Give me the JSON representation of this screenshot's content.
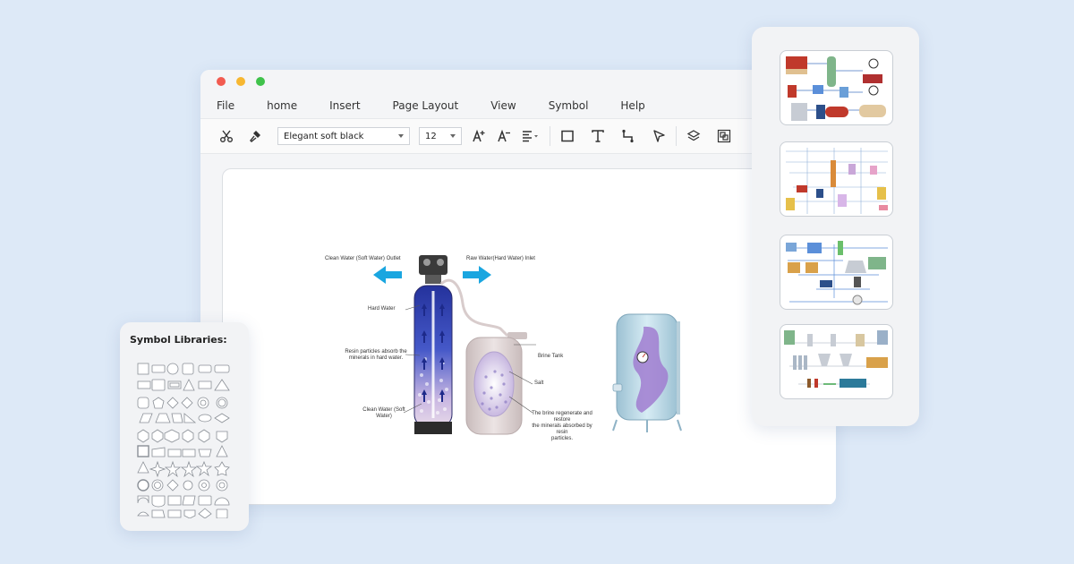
{
  "menu": {
    "items": [
      "File",
      "home",
      "Insert",
      "Page Layout",
      "View",
      "Symbol",
      "Help"
    ]
  },
  "toolbar": {
    "font_name": "Elegant soft black",
    "font_size": "12",
    "icons": [
      "cut-icon",
      "format-painter-icon",
      "font-grow-icon",
      "font-shrink-icon",
      "align-icon",
      "rectangle-icon",
      "text-icon",
      "connector-icon",
      "pointer-icon",
      "layers-icon",
      "group-icon"
    ]
  },
  "diagram": {
    "labels": {
      "clean_outlet": "Clean Water (Soft Water) Outlet",
      "raw_inlet": "Raw Water(Hard Water) Inlet",
      "hard_water": "Hard Water",
      "resin_line1": "Resin particles absorb the",
      "resin_line2": "minerals in hard water.",
      "clean_water_line1": "Clean Water (Soft",
      "clean_water_line2": "Water)",
      "brine_tank": "Brine Tank",
      "salt": "Salt",
      "brine_line1": "The brine regenerate and restore",
      "brine_line2": "the minerals absorbed by resin",
      "brine_line3": "particles."
    },
    "colors": {
      "arrow": "#1aa6e0",
      "resin": "#2b3fb8",
      "tank": "#b9d6e3",
      "brine": "#d8cfcf"
    }
  },
  "symbol_library": {
    "title": "Symbol Libraries:"
  },
  "templates": {
    "thumbnails": [
      "process-template-1",
      "process-template-2",
      "process-template-3",
      "process-template-4"
    ]
  }
}
